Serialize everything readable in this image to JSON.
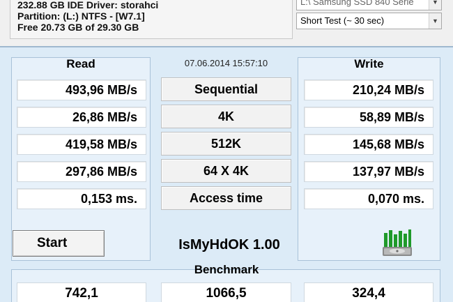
{
  "drive_info": {
    "line1": "232.88 GB  IDE Driver: storahci",
    "line2": "Partition: (L:) NTFS - [W7.1]",
    "line3": "Free 20.73 GB of 29.30 GB"
  },
  "drive_select": {
    "value": "L:\\ Samsung SSD 840 Serie"
  },
  "test_select": {
    "value": "Short Test (~ 30 sec)"
  },
  "timestamp": "07.06.2014 15:57:10",
  "read": {
    "header": "Read",
    "values": [
      "493,96 MB/s",
      "26,86 MB/s",
      "419,58 MB/s",
      "297,86 MB/s",
      "0,153 ms."
    ]
  },
  "write": {
    "header": "Write",
    "values": [
      "210,24 MB/s",
      "58,89 MB/s",
      "145,68 MB/s",
      "137,97 MB/s",
      "0,070 ms."
    ]
  },
  "tests": [
    "Sequential",
    "4K",
    "512K",
    "64 X 4K",
    "Access time"
  ],
  "start_label": "Start",
  "app_title": "IsMyHdOK 1.00",
  "benchmark": {
    "header": "Benchmark",
    "values": [
      "742,1",
      "1066,5",
      "324,4"
    ]
  },
  "icons": {
    "app": "hard-drive-bars-icon"
  },
  "colors": {
    "panel_bg": "#dcebf7",
    "icon_green": "#1f9a2a"
  }
}
